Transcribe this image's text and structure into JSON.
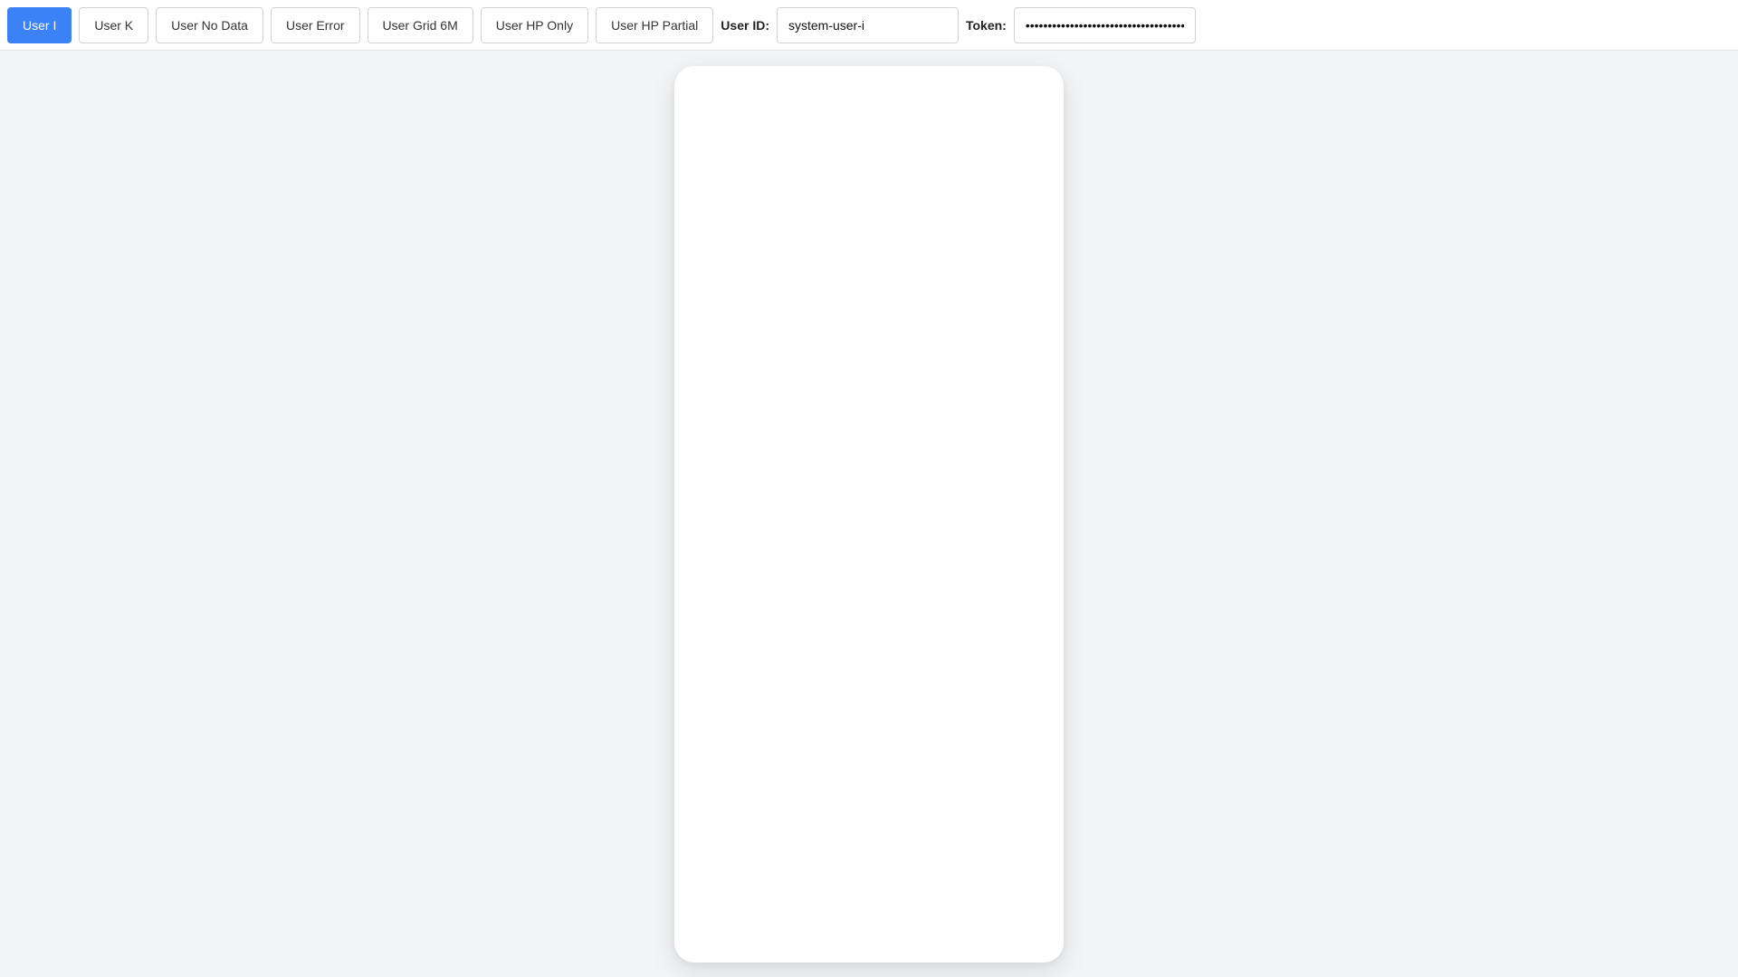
{
  "toolbar": {
    "buttons": [
      {
        "label": "User I",
        "active": true
      },
      {
        "label": "User K",
        "active": false
      },
      {
        "label": "User No Data",
        "active": false
      },
      {
        "label": "User Error",
        "active": false
      },
      {
        "label": "User Grid 6M",
        "active": false
      },
      {
        "label": "User HP Only",
        "active": false
      },
      {
        "label": "User HP Partial",
        "active": false
      }
    ],
    "user_id_label": "User ID:",
    "user_id_value": "system-user-i",
    "token_label": "Token:",
    "token_value": "••••••••••••••••••••••••••••••••••••"
  },
  "colors": {
    "accent": "#3b82f6",
    "page_background": "#f3f4f6",
    "card_background": "#ffffff"
  }
}
